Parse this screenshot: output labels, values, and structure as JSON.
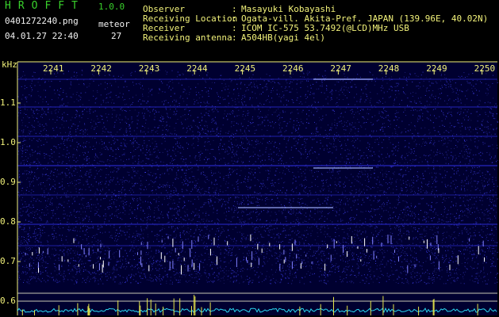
{
  "header": {
    "app_title": "HROFFT",
    "app_version": "1.0.0",
    "file_name": "0401272240.png",
    "meteor_label": "meteor",
    "datetime": "04.01.27 22:40",
    "meteor_count": "27"
  },
  "meta": [
    {
      "key": "Observer",
      "value": "Masayuki Kobayashi"
    },
    {
      "key": "Receiving Location",
      "value": "Ogata-vill. Akita-Pref. JAPAN (139.96E, 40.02N)"
    },
    {
      "key": "Receiver",
      "value": "ICOM IC-575 53.7492(@LCD)MHz USB"
    },
    {
      "key": "Receiving antenna",
      "value": "A504HB(yagi 4el)"
    }
  ],
  "spectrogram": {
    "freq_unit": "kHz",
    "time_ticks": [
      "2241",
      "2242",
      "2243",
      "2244",
      "2245",
      "2246",
      "2247",
      "2248",
      "2249",
      "2250"
    ],
    "freq_ticks": [
      "1.1",
      "1.0",
      "0.9",
      "0.8",
      "0.7",
      "0.6"
    ],
    "colors": {
      "background": "#000030",
      "noise": "#2828c8",
      "echo": "#ffffff",
      "axis": "#f2f27a",
      "baseline": "#2ad8f0"
    }
  }
}
